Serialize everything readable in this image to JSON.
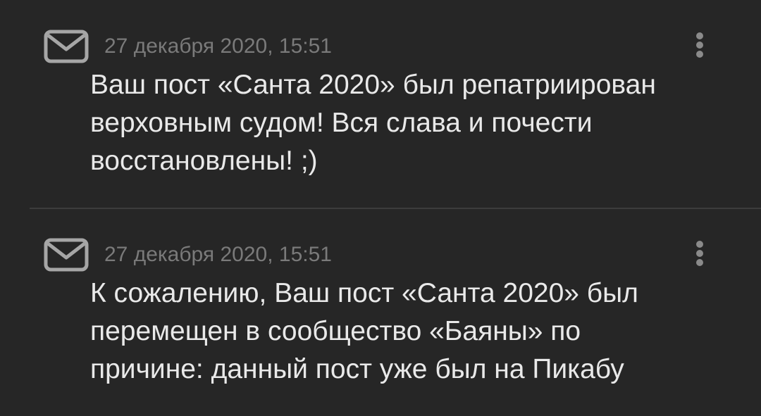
{
  "notifications": [
    {
      "icon": "envelope-icon",
      "timestamp": "27 декабря 2020, 15:51",
      "message_lines": [
        "Ваш пост «Санта 2020» был репатриирован",
        "верховным судом! Вся слава и почести",
        "восстановлены! ;)"
      ]
    },
    {
      "icon": "envelope-icon",
      "timestamp": "27 декабря 2020, 15:51",
      "message_lines": [
        "К сожалению, Ваш пост «Санта 2020» был",
        "перемещен в сообщество «Баяны» по",
        "причине: данный пост уже был на Пикабу"
      ]
    }
  ],
  "colors": {
    "background": "#262626",
    "message_text": "#e9e9e9",
    "timestamp_text": "#7a7a7a",
    "icon": "#a6a6a6",
    "divider": "#3c3c3c"
  }
}
